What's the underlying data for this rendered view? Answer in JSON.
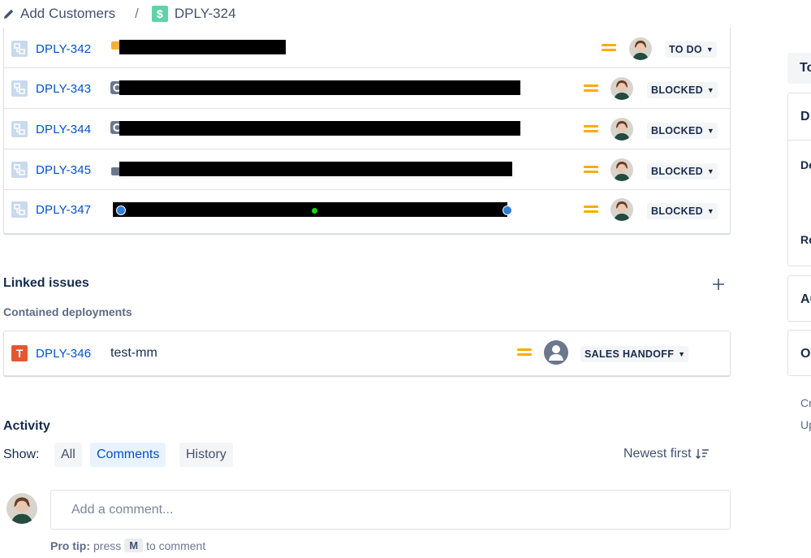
{
  "breadcrumb": {
    "parent_label": "Add Customers",
    "separator": "/",
    "current_key": "DPLY-324",
    "current_icon": "dollar-icon"
  },
  "child_issues": [
    {
      "key": "DPLY-342",
      "status": "TO DO"
    },
    {
      "key": "DPLY-343",
      "status": "BLOCKED"
    },
    {
      "key": "DPLY-344",
      "status": "BLOCKED"
    },
    {
      "key": "DPLY-345",
      "status": "BLOCKED"
    },
    {
      "key": "DPLY-347",
      "status": "BLOCKED"
    }
  ],
  "linked_issues": {
    "title": "Linked issues",
    "subtitle": "Contained deployments",
    "items": [
      {
        "key": "DPLY-346",
        "summary": "test-mm",
        "status": "SALES HANDOFF"
      }
    ]
  },
  "activity": {
    "title": "Activity",
    "show_label": "Show:",
    "filters": [
      "All",
      "Comments",
      "History"
    ],
    "active_filter": "Comments",
    "sort_label": "Newest first",
    "comment_placeholder": "Add a comment...",
    "pro_tip_label": "Pro tip:",
    "pro_tip_press": "press",
    "pro_tip_key": "M",
    "pro_tip_suffix": "to comment"
  },
  "right_panel": {
    "button_text": "To",
    "card1_title": "D",
    "card1_line1": "De",
    "card1_line2": "Re",
    "card2_title": "Au",
    "card3_title": "O",
    "created_label": "Cr",
    "updated_label": "Up"
  },
  "colors": {
    "link": "#0052cc",
    "priority_medium": "#ffab00",
    "dollar_icon": "#5fd3a6",
    "task_icon": "#e2592f"
  }
}
